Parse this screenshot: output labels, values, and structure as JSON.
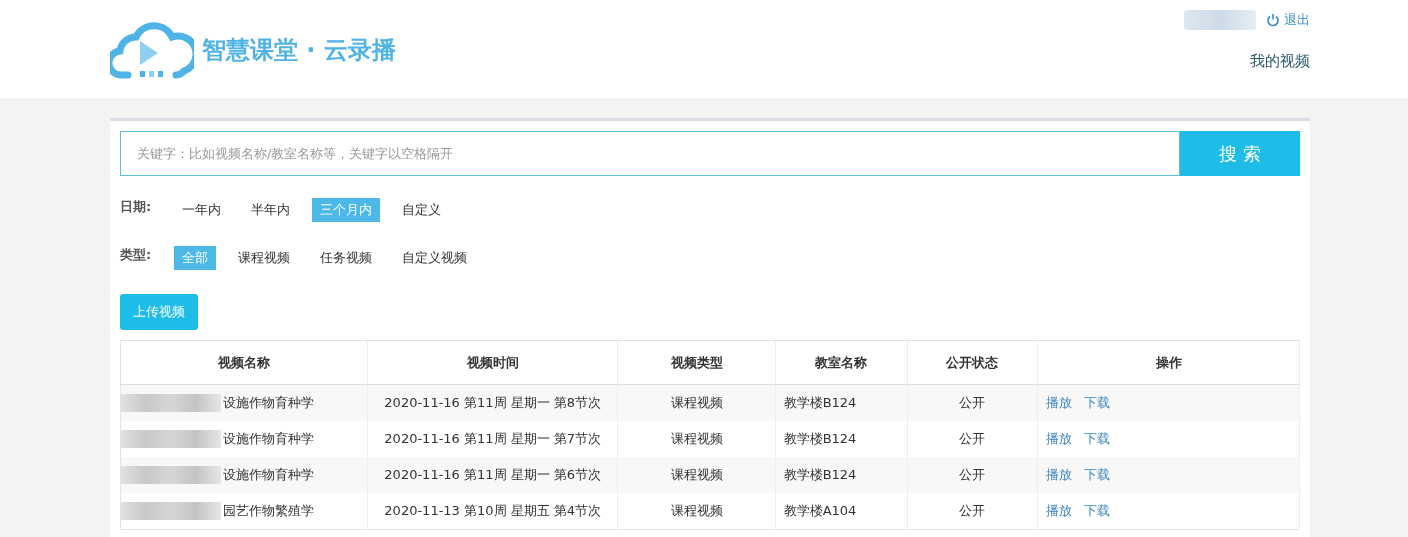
{
  "header": {
    "logo_text": "智慧课堂 · 云录播",
    "logout": "退出",
    "nav_link": "我的视频"
  },
  "search": {
    "placeholder": "关键字：比如视频名称/教室名称等，关键字以空格隔开",
    "button": "搜 索"
  },
  "filters": [
    {
      "label": "日期:",
      "options": [
        {
          "label": "一年内",
          "selected": false
        },
        {
          "label": "半年内",
          "selected": false
        },
        {
          "label": "三个月内",
          "selected": true
        },
        {
          "label": "自定义",
          "selected": false
        }
      ]
    },
    {
      "label": "类型:",
      "options": [
        {
          "label": "全部",
          "selected": true
        },
        {
          "label": "课程视频",
          "selected": false
        },
        {
          "label": "任务视频",
          "selected": false
        },
        {
          "label": "自定义视频",
          "selected": false
        }
      ]
    }
  ],
  "upload_button": "上传视频",
  "table": {
    "columns": [
      "视频名称",
      "视频时间",
      "视频类型",
      "教室名称",
      "公开状态",
      "操作"
    ],
    "rows": [
      {
        "name": "设施作物育种学",
        "time": "2020-11-16 第11周 星期一 第8节次",
        "type": "课程视频",
        "room": "教学楼B124",
        "status": "公开",
        "actions": [
          "播放",
          "下载"
        ]
      },
      {
        "name": "设施作物育种学",
        "time": "2020-11-16 第11周 星期一 第7节次",
        "type": "课程视频",
        "room": "教学楼B124",
        "status": "公开",
        "actions": [
          "播放",
          "下载"
        ]
      },
      {
        "name": "设施作物育种学",
        "time": "2020-11-16 第11周 星期一 第6节次",
        "type": "课程视频",
        "room": "教学楼B124",
        "status": "公开",
        "actions": [
          "播放",
          "下载"
        ]
      },
      {
        "name": "园艺作物繁殖学",
        "time": "2020-11-13 第10周 星期五 第4节次",
        "type": "课程视频",
        "room": "教学楼A104",
        "status": "公开",
        "actions": [
          "播放",
          "下载"
        ]
      }
    ]
  }
}
